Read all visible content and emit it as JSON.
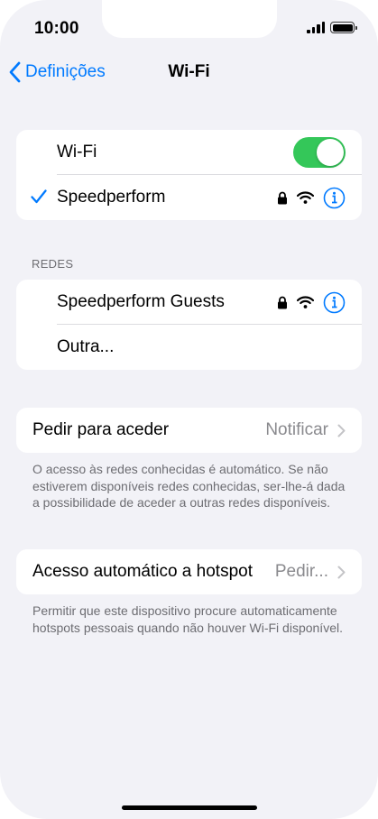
{
  "status_bar": {
    "time": "10:00",
    "signal_icon": "cellular-signal-icon",
    "battery_icon": "battery-icon"
  },
  "nav": {
    "back_label": "Definições",
    "back_icon": "chevron-left-icon",
    "title": "Wi-Fi"
  },
  "wifi_group": {
    "toggle_label": "Wi-Fi",
    "toggle_on": true,
    "connected_network": {
      "name": "Speedperform",
      "icons": [
        "checkmark-icon",
        "lock-icon",
        "wifi-icon",
        "info-icon"
      ]
    }
  },
  "networks_section": {
    "header": "REDES",
    "items": [
      {
        "name": "Speedperform Guests",
        "icons": [
          "lock-icon",
          "wifi-icon",
          "info-icon"
        ]
      },
      {
        "name": "Outra..."
      }
    ]
  },
  "ask_to_join": {
    "label": "Pedir para aceder",
    "value": "Notificar",
    "footnote": "O acesso às redes conhecidas é automático. Se não estiverem disponíveis redes conhecidas, ser-lhe-á dada a possibilidade de aceder a outras redes disponíveis."
  },
  "auto_hotspot": {
    "label": "Acesso automático a hotspot",
    "value": "Pedir...",
    "footnote": "Permitir que este dispositivo procure automaticamente hotspots pessoais quando não houver Wi-Fi disponível."
  },
  "colors": {
    "accent": "#007aff",
    "toggle_on": "#34c759",
    "background": "#f2f2f7",
    "secondary_text": "#8a8a8e"
  }
}
